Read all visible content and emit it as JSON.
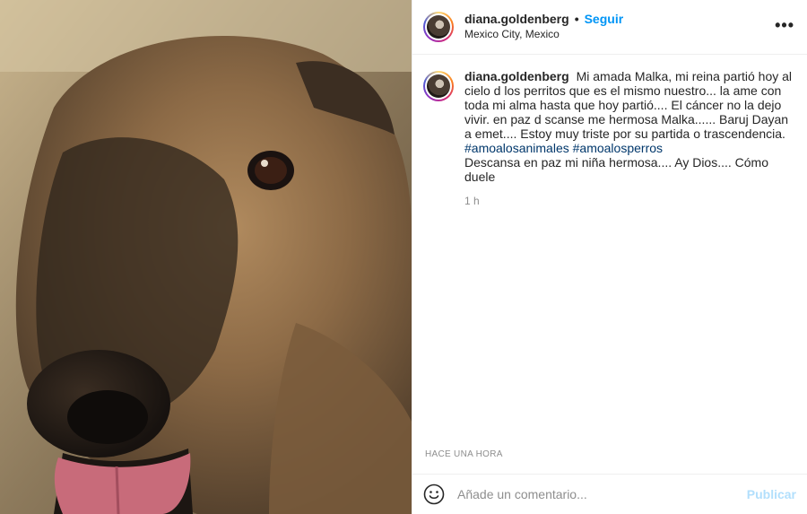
{
  "post": {
    "username": "diana.goldenberg",
    "separator": "•",
    "follow_label": "Seguir",
    "location": "Mexico City, Mexico",
    "more_icon": "ellipsis-icon",
    "caption": {
      "text": "Mi amada Malka, mi reina partió hoy al cielo d los perritos que es el mismo nuestro... la ame con toda mi alma hasta que hoy partió.... El cáncer no la dejo vivir. en paz d scanse me hermosa Malka...... Baruj Dayan a emet.... Estoy muy triste por su partida o trascendencia.",
      "hashtags": [
        "#amoalosanimales",
        "#amoalosperros"
      ],
      "closing": "Descansa en paz mi niña hermosa.... Ay Dios.... Cómo duele"
    },
    "relative_time": "1 h",
    "absolute_time": "HACE UNA HORA"
  },
  "comment": {
    "emoji_icon": "smiley-icon",
    "placeholder": "Añade un comentario...",
    "publish_label": "Publicar"
  },
  "colors": {
    "accent": "#0095f6",
    "publish_disabled": "#b2dffc",
    "hashtag": "#00376b",
    "muted": "#8e8e8e"
  }
}
